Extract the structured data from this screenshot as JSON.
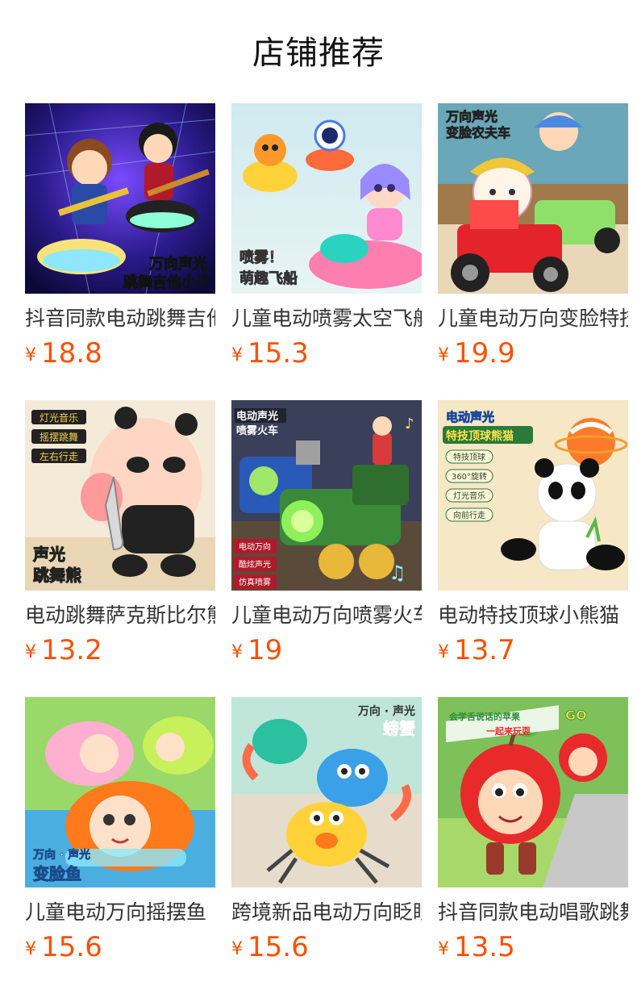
{
  "section": {
    "title": "店铺推荐"
  },
  "products": [
    {
      "name": "抖音同款电动跳舞吉他小子",
      "currency": "¥",
      "price": "18.8",
      "image_badge_lines": [
        "万向声光",
        "跳舞吉他小子"
      ],
      "icon": "dancing-guitar-boy-toy-image"
    },
    {
      "name": "儿童电动喷雾太空飞船",
      "currency": "¥",
      "price": "15.3",
      "image_badge_lines": [
        "喷雾！",
        "萌趣飞船"
      ],
      "icon": "spray-spaceship-toy-image"
    },
    {
      "name": "儿童电动万向变脸特技农夫车",
      "currency": "¥",
      "price": "19.9",
      "image_badge_lines": [
        "万向声光",
        "变脸农夫车"
      ],
      "icon": "face-changing-farmer-car-toy-image"
    },
    {
      "name": "电动跳舞萨克斯比尔熊",
      "currency": "¥",
      "price": "13.2",
      "image_badge_lines": [
        "声光",
        "跳舞熊"
      ],
      "image_feature_tags": [
        "灯光音乐",
        "摇摆跳舞",
        "左右行走"
      ],
      "icon": "saxophone-bear-toy-image"
    },
    {
      "name": "儿童电动万向喷雾火车",
      "currency": "¥",
      "price": "19",
      "image_badge_lines": [
        "电动声光",
        "喷雾火车"
      ],
      "image_feature_tags": [
        "电动万向",
        "酷炫声光",
        "仿真喷雾"
      ],
      "icon": "spray-train-toy-image"
    },
    {
      "name": "电动特技顶球小熊猫",
      "currency": "¥",
      "price": "13.7",
      "image_badge_lines": [
        "电动声光",
        "特技顶球熊猫"
      ],
      "image_feature_tags": [
        "特技顶球",
        "360°旋转",
        "灯光音乐",
        "向前行走"
      ],
      "icon": "ball-balancing-panda-toy-image"
    },
    {
      "name": "儿童电动万向摇摆鱼",
      "currency": "¥",
      "price": "15.6",
      "image_badge_lines": [
        "万向 · 声光",
        "变脸鱼"
      ],
      "icon": "swinging-fish-toy-image"
    },
    {
      "name": "跨境新品电动万向眨眼螃蟹",
      "currency": "¥",
      "price": "15.6",
      "image_badge_lines": [
        "万向 · 声光",
        "螃蟹"
      ],
      "icon": "crab-toy-image"
    },
    {
      "name": "抖音同款电动唱歌跳舞苹果",
      "currency": "¥",
      "price": "13.5",
      "image_badge_lines": [
        "会学舌说话的苹果",
        "一起来玩耍"
      ],
      "icon": "singing-apple-toy-image"
    }
  ],
  "colors": {
    "price": "#ff5000",
    "title": "#111111",
    "text": "#333333"
  }
}
